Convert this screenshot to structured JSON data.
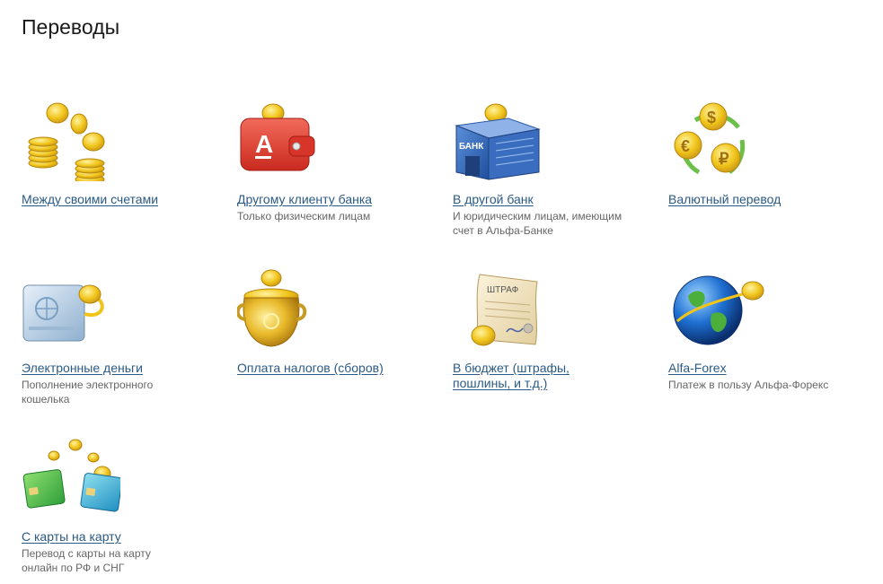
{
  "page": {
    "title": "Переводы"
  },
  "tiles": [
    {
      "label": "Между своими счетами",
      "desc": ""
    },
    {
      "label": "Другому клиенту банка",
      "desc": "Только физическим лицам"
    },
    {
      "label": "В другой банк",
      "desc": "И юридическим лицам, имеющим счет в Альфа-Банке",
      "bank_sign": "БАНК"
    },
    {
      "label": "Валютный перевод",
      "desc": ""
    },
    {
      "label": "Электронные деньги",
      "desc": "Пополнение электронного кошелька"
    },
    {
      "label": "Оплата налогов (сборов)",
      "desc": ""
    },
    {
      "label": "В бюджет (штрафы, пошлины, и т.д.)",
      "desc": "",
      "doc_word": "ШТРАФ"
    },
    {
      "label": "Alfa-Forex",
      "desc": "Платеж в пользу Альфа-Форекс"
    },
    {
      "label": "С карты на карту",
      "desc": "Перевод с карты на карту онлайн по РФ и СНГ"
    }
  ],
  "icons": [
    "coins-stack-icon",
    "wallet-icon",
    "bank-building-icon",
    "currency-exchange-icon",
    "e-money-card-icon",
    "gold-pot-icon",
    "fine-document-icon",
    "globe-icon",
    "cards-transfer-icon"
  ],
  "colors": {
    "link": "#2a5a85",
    "desc": "#666666",
    "title": "#1a1a1a",
    "coin": "#f0c419",
    "coin_dark": "#c8961a"
  }
}
